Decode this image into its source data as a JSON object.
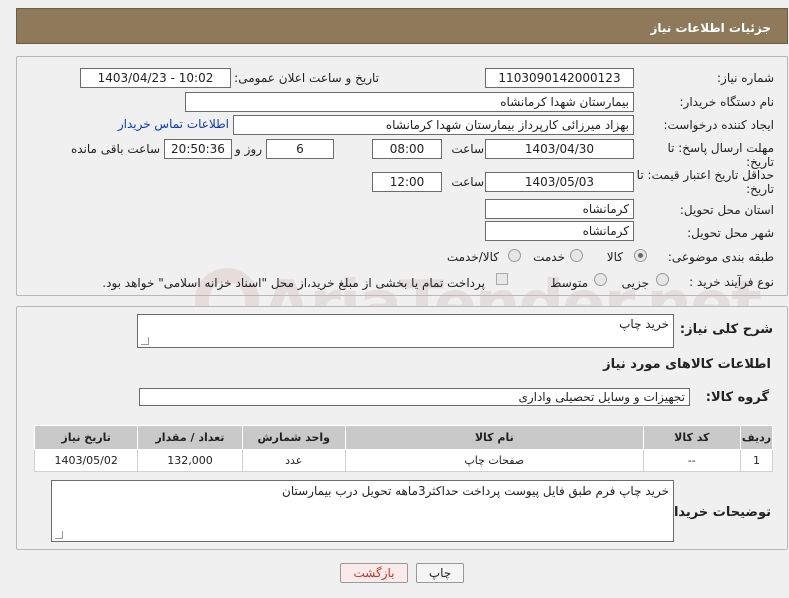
{
  "header": {
    "title": "جزئیات اطلاعات نیاز"
  },
  "fields": {
    "need_number_label": "شماره نیاز:",
    "need_number": "1103090142000123",
    "announce_label": "تاریخ و ساعت اعلان عمومی:",
    "announce_value": "1403/04/23 - 10:02",
    "buyer_org_label": "نام دستگاه خریدار:",
    "buyer_org": "بیمارستان شهدا کرمانشاه",
    "creator_label": "ایجاد کننده درخواست:",
    "creator": "بهزاد میرزائی کارپرداز بیمارستان شهدا کرمانشاه",
    "contact_link": "اطلاعات تماس خریدار",
    "deadline_label_1": "مهلت ارسال پاسخ: تا",
    "deadline_label_2": "تاریخ:",
    "deadline_date": "1403/04/30",
    "time_label": "ساعت",
    "deadline_time": "08:00",
    "days": "6",
    "days_label": "روز و",
    "remaining_time": "20:50:36",
    "remaining_label": "ساعت باقی مانده",
    "validity_label_1": "حداقل تاریخ اعتبار قیمت: تا",
    "validity_label_2": "تاریخ:",
    "validity_date": "1403/05/03",
    "validity_time_label": "ساعت",
    "validity_time": "12:00",
    "province_label": "استان محل تحویل:",
    "province": "کرمانشاه",
    "city_label": "شهر محل تحویل:",
    "city": "کرمانشاه",
    "category_label": "طبقه بندی موضوعی:",
    "category_options": [
      "کالا",
      "خدمت",
      "کالا/خدمت"
    ],
    "process_label": "نوع فرآیند خرید :",
    "process_options": [
      "جزیی",
      "متوسط"
    ],
    "payment_note": "پرداخت تمام یا بخشی از مبلغ خرید،از محل \"اسناد خزانه اسلامی\" خواهد بود."
  },
  "summary": {
    "label": "شرح کلی نیاز:",
    "value": "خرید چاپ",
    "items_title": "اطلاعات کالاهای مورد نیاز",
    "group_label": "گروه کالا:",
    "group_value": "تجهیزات و وسایل تحصیلی واداری"
  },
  "table": {
    "headers": [
      "ردیف",
      "کد کالا",
      "نام کالا",
      "واحد شمارش",
      "تعداد / مقدار",
      "تاریخ نیاز"
    ],
    "rows": [
      [
        "1",
        "--",
        "صفحات چاپ",
        "عدد",
        "132,000",
        "1403/05/02"
      ]
    ]
  },
  "notes": {
    "label": "توضیحات خریدار:",
    "value": "خرید چاپ فرم طبق فایل پیوست پرداخت حداکثر3ماهه تحویل درب بیمارستان"
  },
  "buttons": {
    "print": "چاپ",
    "back": "بازگشت"
  },
  "watermark": "AriaTender.net",
  "colors": {
    "header": "#8e7a5b",
    "link": "#0a3bb5",
    "back_button_text": "#c0392b"
  }
}
